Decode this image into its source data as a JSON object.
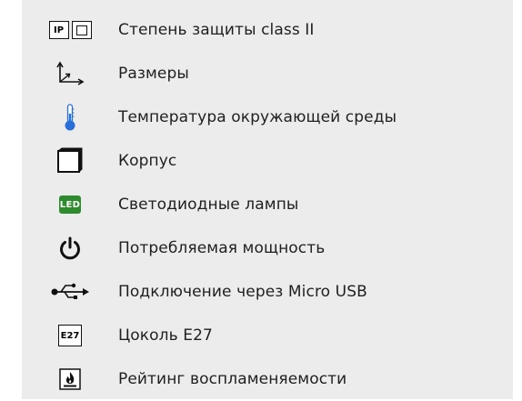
{
  "legend": {
    "items": [
      {
        "icon": "ip-protection-icon",
        "ip_text": "IP",
        "label": "Степень защиты class II"
      },
      {
        "icon": "dimensions-axes-icon",
        "label": "Размеры"
      },
      {
        "icon": "thermometer-icon",
        "label": "Температура окружающей среды"
      },
      {
        "icon": "housing-cube-icon",
        "label": "Корпус"
      },
      {
        "icon": "led-icon",
        "badge_text": "LED",
        "label": "Светодиодные лампы"
      },
      {
        "icon": "power-icon",
        "label": "Потребляемая мощность"
      },
      {
        "icon": "usb-icon",
        "label": "Подключение через Micro USB"
      },
      {
        "icon": "e27-socket-icon",
        "badge_text": "E27",
        "label": "Цоколь E27"
      },
      {
        "icon": "flammability-icon",
        "label": "Рейтинг воспламеняемости"
      }
    ]
  },
  "colors": {
    "panel_background": "#ececec",
    "text": "#1f1f1f",
    "led_green": "#2e8b2e",
    "thermometer_blue": "#2a6fd6"
  }
}
